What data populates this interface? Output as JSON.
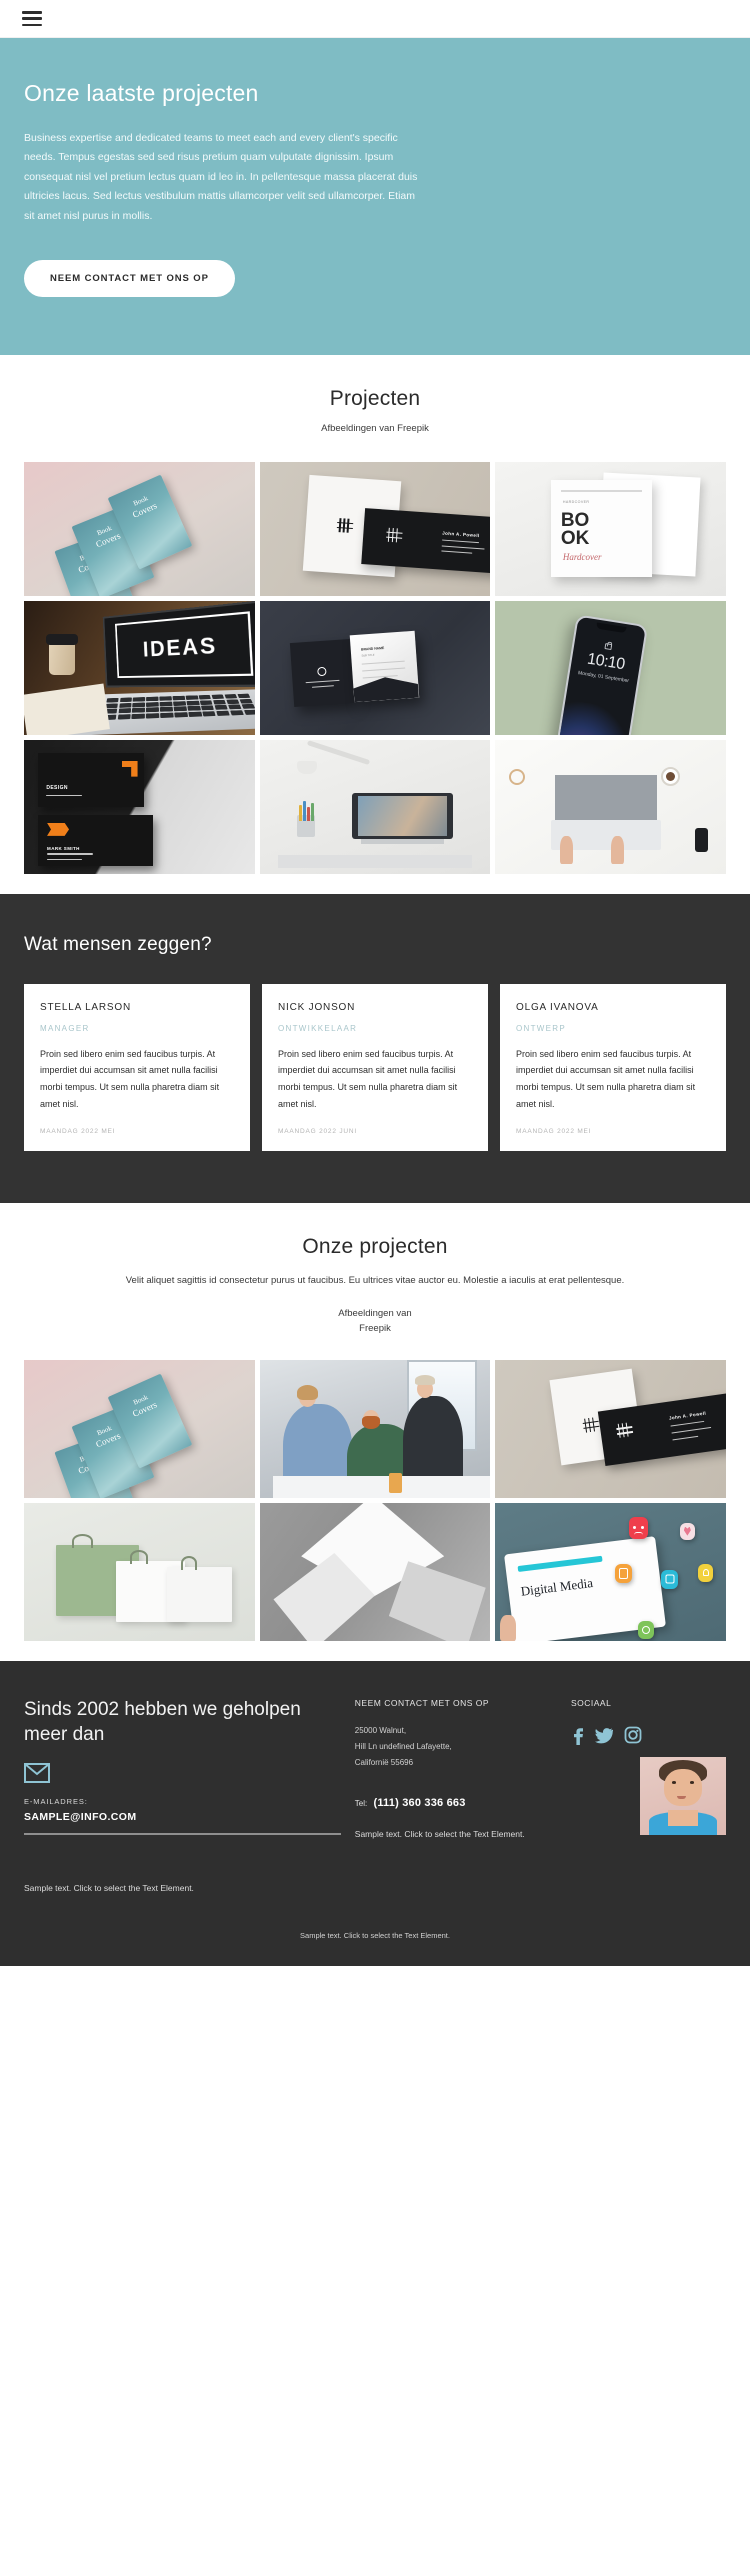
{
  "topbar": {
    "menu_icon": "hamburger-menu-icon"
  },
  "hero": {
    "title": "Onze laatste projecten",
    "paragraph": "Business expertise and dedicated teams to meet each and every client's specific needs. Tempus egestas sed sed risus pretium quam vulputate dignissim. Ipsum consequat nisl vel pretium lectus quam id leo in. In pellentesque massa placerat duis ultricies lacus. Sed lectus vestibulum mattis ullamcorper velit sed ullamcorper. Etiam sit amet nisl purus in mollis.",
    "cta_label": "NEEM CONTACT MET ONS OP",
    "bg_color": "#7fbcc4"
  },
  "projects_section": {
    "title": "Projecten",
    "credit": "Afbeeldingen van Freepik",
    "images": [
      {
        "name": "book-covers-mockup",
        "caption": "Book Covers"
      },
      {
        "name": "business-card-stationery-light",
        "caption": "John A. Powell"
      },
      {
        "name": "book-hardcover-mockup",
        "caption": "BOOK Hardcover"
      },
      {
        "name": "laptop-ideas-workspace",
        "caption": "IDEAS"
      },
      {
        "name": "dark-business-cards",
        "caption": ""
      },
      {
        "name": "smartphone-lockscreen-mockup",
        "caption": "10:10"
      },
      {
        "name": "orange-black-branding-cards",
        "caption": "DESIGN"
      },
      {
        "name": "desk-workspace-monitor",
        "caption": ""
      },
      {
        "name": "overhead-desk-laptop-hands",
        "caption": ""
      }
    ],
    "phone_mockup": {
      "time": "10:10",
      "date": "Monday, 01 September"
    }
  },
  "testimonials_section": {
    "title": "Wat mensen zeggen?",
    "cards": [
      {
        "name": "STELLA LARSON",
        "role": "MANAGER",
        "text": "Proin sed libero enim sed faucibus turpis. At imperdiet dui accumsan sit amet nulla facilisi morbi tempus. Ut sem nulla pharetra diam sit amet nisl.",
        "date": "MAANDAG 2022 MEI"
      },
      {
        "name": "NICK JONSON",
        "role": "ONTWIKKELAAR",
        "text": "Proin sed libero enim sed faucibus turpis. At imperdiet dui accumsan sit amet nulla facilisi morbi tempus. Ut sem nulla pharetra diam sit amet nisl.",
        "date": "MAANDAG 2022 JUNI"
      },
      {
        "name": "OLGA IVANOVA",
        "role": "ONTWERP",
        "text": "Proin sed libero enim sed faucibus turpis. At imperdiet dui accumsan sit amet nulla facilisi morbi tempus. Ut sem nulla pharetra diam sit amet nisl.",
        "date": "MAANDAG 2022 MEI"
      }
    ],
    "bg_color": "#333333",
    "role_color": "#a9c6cb"
  },
  "our_projects_section": {
    "title": "Onze projecten",
    "subtitle": "Velit aliquet sagittis id consectetur purus ut faucibus. Eu ultrices vitae auctor eu. Molestie a iaculis at erat pellentesque.",
    "credit_line1": "Afbeeldingen van",
    "credit_line2": "Freepik",
    "images": [
      {
        "name": "book-covers-mockup"
      },
      {
        "name": "team-meeting-office"
      },
      {
        "name": "business-cards-black-white"
      },
      {
        "name": "shopping-bags-mockup"
      },
      {
        "name": "abstract-paper-folds"
      },
      {
        "name": "digital-media-tablet"
      }
    ],
    "tablet_caption": "Digital Media"
  },
  "footer": {
    "heading": "Sinds 2002 hebben we geholpen meer dan",
    "mail_icon": "envelope-icon",
    "email_label": "E-MAILADRES:",
    "email_value": "SAMPLE@INFO.COM",
    "contact_title": "NEEM CONTACT MET ONS OP",
    "address": [
      "25000 Walnut,",
      "Hill Ln undefined Lafayette,",
      "Californië 55696"
    ],
    "social_title": "SOCIAAL",
    "socials": [
      "facebook-icon",
      "twitter-icon",
      "instagram-icon"
    ],
    "social_color": "#8fc4d4",
    "tel_label": "Tel:",
    "tel_value": "(111) 360 336 663",
    "sample_left": "Sample text. Click to select the Text Element.",
    "sample_right": "Sample text. Click to select the Text Element.",
    "sample_bottom": "Sample text. Click to select the Text Element.",
    "portrait": "man-portrait-photo",
    "bg_color": "#2f2f2f"
  }
}
